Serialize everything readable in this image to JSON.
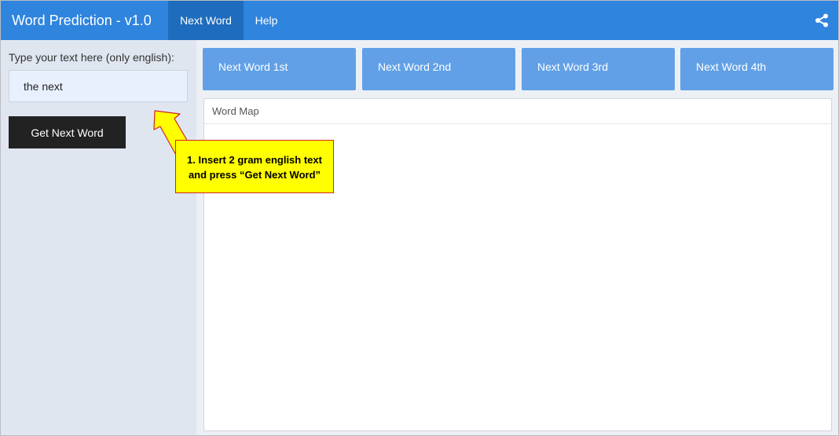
{
  "header": {
    "brand": "Word Prediction - v1.0",
    "tabs": [
      {
        "label": "Next Word",
        "active": true
      },
      {
        "label": "Help",
        "active": false
      }
    ],
    "share_icon": "share-icon",
    "background": "#2f84de"
  },
  "sidebar": {
    "input_label": "Type your text here (only english):",
    "input_value": "the next",
    "submit_label": "Get Next Word"
  },
  "main": {
    "word_buttons": [
      "Next Word 1st",
      "Next Word 2nd",
      "Next Word 3rd",
      "Next Word 4th"
    ],
    "word_map_title": "Word Map"
  },
  "annotation": {
    "line1": "1. Insert 2 gram english text",
    "line2": "and press “Get Next Word”",
    "background": "#ffff00",
    "border": "#d02525"
  }
}
